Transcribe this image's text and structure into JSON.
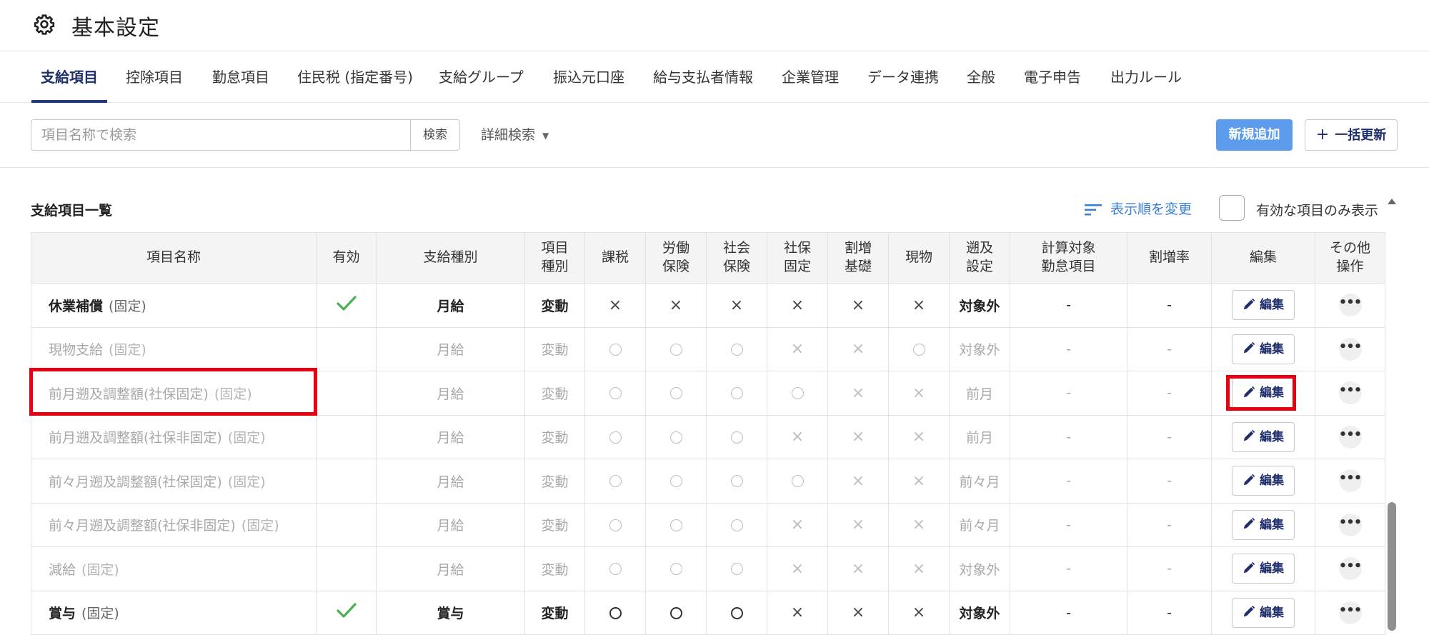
{
  "header": {
    "title": "基本設定",
    "icon": "gear-icon"
  },
  "tabs": [
    {
      "label": "支給項目",
      "active": true
    },
    {
      "label": "控除項目",
      "active": false
    },
    {
      "label": "勤怠項目",
      "active": false
    },
    {
      "label": "住民税 (指定番号)",
      "active": false
    },
    {
      "label": "支給グループ",
      "active": false
    },
    {
      "label": "振込元口座",
      "active": false
    },
    {
      "label": "給与支払者情報",
      "active": false
    },
    {
      "label": "企業管理",
      "active": false
    },
    {
      "label": "データ連携",
      "active": false
    },
    {
      "label": "全般",
      "active": false
    },
    {
      "label": "電子申告",
      "active": false
    },
    {
      "label": "出力ルール",
      "active": false
    }
  ],
  "toolbar": {
    "search_placeholder": "項目名称で検索",
    "search_button": "検索",
    "advanced_search": "詳細検索",
    "new_button": "新規追加",
    "bulk_update_button": "一括更新"
  },
  "list": {
    "title": "支給項目一覧",
    "sort_link": "表示順を変更",
    "only_active_label": "有効な項目のみ表示",
    "only_active_checked": false
  },
  "table": {
    "headers": [
      "項目名称",
      "有効",
      "支給種別",
      "項目\n種別",
      "課税",
      "労働\n保険",
      "社会\n保険",
      "社保\n固定",
      "割増\n基礎",
      "現物",
      "遡及\n設定",
      "計算対象\n勤怠項目",
      "割増率",
      "編集",
      "その他\n操作"
    ],
    "edit_label": "編集",
    "more_label": "•••",
    "fixed_label": "(固定)",
    "rows": [
      {
        "name": "休業補償",
        "active": true,
        "pay_type": "月給",
        "item_type": "変動",
        "taxable": "×",
        "labor_ins": "×",
        "social_ins": "×",
        "social_fixed": "×",
        "premium_base": "×",
        "in_kind": "×",
        "retro": "対象外",
        "calc_attendance": "-",
        "premium_rate": "-"
      },
      {
        "name": "現物支給",
        "active": false,
        "pay_type": "月給",
        "item_type": "変動",
        "taxable": "○",
        "labor_ins": "○",
        "social_ins": "○",
        "social_fixed": "×",
        "premium_base": "×",
        "in_kind": "○",
        "retro": "対象外",
        "calc_attendance": "-",
        "premium_rate": "-"
      },
      {
        "name": "前月遡及調整額(社保固定)",
        "active": false,
        "pay_type": "月給",
        "item_type": "変動",
        "taxable": "○",
        "labor_ins": "○",
        "social_ins": "○",
        "social_fixed": "○",
        "premium_base": "×",
        "in_kind": "×",
        "retro": "前月",
        "calc_attendance": "-",
        "premium_rate": "-"
      },
      {
        "name": "前月遡及調整額(社保非固定)",
        "active": false,
        "pay_type": "月給",
        "item_type": "変動",
        "taxable": "○",
        "labor_ins": "○",
        "social_ins": "○",
        "social_fixed": "×",
        "premium_base": "×",
        "in_kind": "×",
        "retro": "前月",
        "calc_attendance": "-",
        "premium_rate": "-"
      },
      {
        "name": "前々月遡及調整額(社保固定)",
        "active": false,
        "pay_type": "月給",
        "item_type": "変動",
        "taxable": "○",
        "labor_ins": "○",
        "social_ins": "○",
        "social_fixed": "○",
        "premium_base": "×",
        "in_kind": "×",
        "retro": "前々月",
        "calc_attendance": "-",
        "premium_rate": "-"
      },
      {
        "name": "前々月遡及調整額(社保非固定)",
        "active": false,
        "pay_type": "月給",
        "item_type": "変動",
        "taxable": "○",
        "labor_ins": "○",
        "social_ins": "○",
        "social_fixed": "×",
        "premium_base": "×",
        "in_kind": "×",
        "retro": "前々月",
        "calc_attendance": "-",
        "premium_rate": "-"
      },
      {
        "name": "減給",
        "active": false,
        "pay_type": "月給",
        "item_type": "変動",
        "taxable": "○",
        "labor_ins": "○",
        "social_ins": "○",
        "social_fixed": "×",
        "premium_base": "×",
        "in_kind": "×",
        "retro": "対象外",
        "calc_attendance": "-",
        "premium_rate": "-"
      },
      {
        "name": "賞与",
        "active": true,
        "pay_type": "賞与",
        "item_type": "変動",
        "taxable": "○",
        "labor_ins": "○",
        "social_ins": "○",
        "social_fixed": "×",
        "premium_base": "×",
        "in_kind": "×",
        "retro": "対象外",
        "calc_attendance": "-",
        "premium_rate": "-"
      }
    ]
  },
  "colors": {
    "accent": "#243a80",
    "link": "#3a7fd5",
    "primary_button": "#5d9cec",
    "check": "#4caf50",
    "highlight": "#e60012"
  }
}
